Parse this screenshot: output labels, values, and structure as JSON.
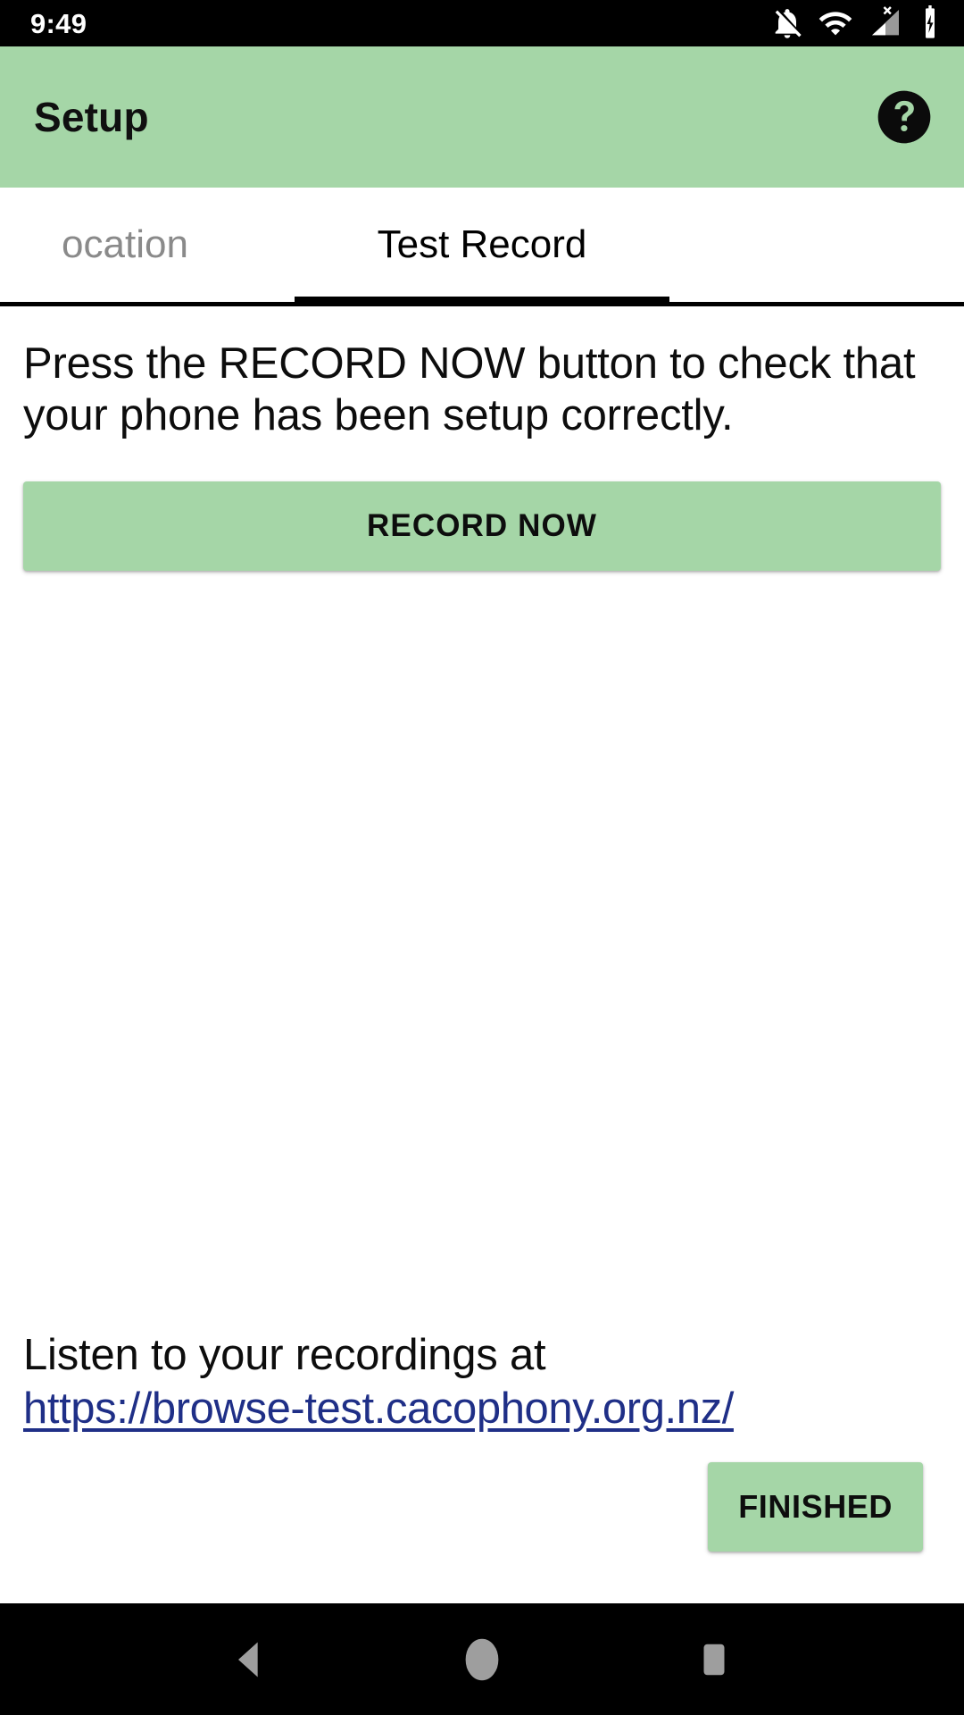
{
  "status_bar": {
    "time": "9:49",
    "icons": [
      {
        "name": "notifications-off-icon",
        "label": "silent"
      },
      {
        "name": "wifi-icon",
        "label": "wifi"
      },
      {
        "name": "cellular-no-sim-icon",
        "label": "no signal"
      },
      {
        "name": "battery-charging-icon",
        "label": "charging"
      }
    ]
  },
  "toolbar": {
    "title": "Setup",
    "help_icon": "help-circle-icon"
  },
  "tabs": [
    {
      "label": "ocation",
      "active": false
    },
    {
      "label": "Test Record",
      "active": true
    }
  ],
  "main": {
    "instructions": "Press the RECORD NOW button to check that your phone has been setup correctly.",
    "record_button": "RECORD NOW",
    "listen_text": "Listen to your recordings at",
    "listen_link": "https://browse-test.cacophony.org.nz/",
    "finished_button": "FINISHED"
  },
  "nav_bar": {
    "back": "back-icon",
    "home": "home-icon",
    "recents": "recents-icon"
  },
  "colors": {
    "accent_green": "#a5d6a7",
    "link_blue": "#1f2f87",
    "text_primary": "#0d0d0d",
    "tab_inactive": "#8a8a8a",
    "status_bar_bg": "#000000"
  }
}
